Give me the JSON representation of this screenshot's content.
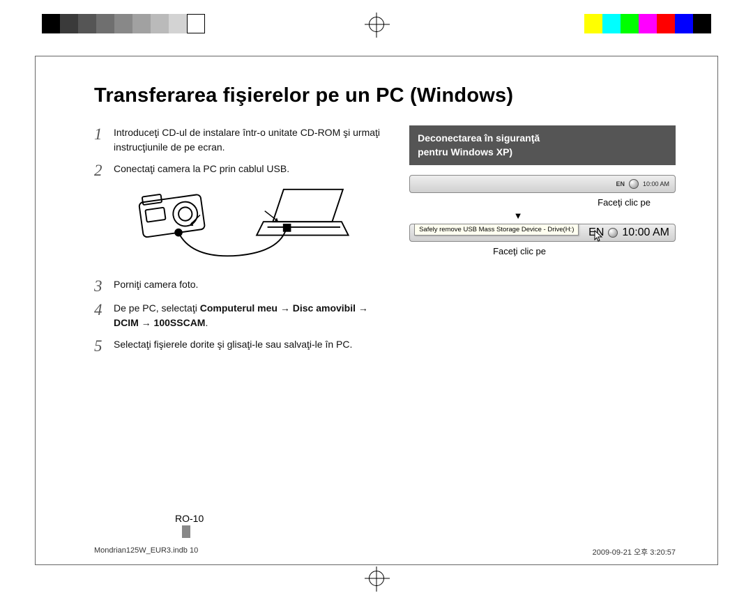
{
  "colorbar": [
    "#000000",
    "#3a3a3a",
    "#555555",
    "#6f6f6f",
    "#888888",
    "#a1a1a1",
    "#bababa",
    "#d3d3d3",
    "#ffffff",
    "#ffffff",
    "#ffff00",
    "#00ffff",
    "#00ff00",
    "#ff00ff",
    "#ff0000",
    "#0000ff",
    "#000000"
  ],
  "title": "Transferarea fişierelor pe un PC (Windows)",
  "steps": {
    "s1": "Introduceţi CD-ul de instalare într-o unitate CD-ROM şi urmaţi instrucţiunile de pe ecran.",
    "s2": "Conectaţi camera la PC prin cablul USB.",
    "s3": "Porniţi camera foto.",
    "s4_prefix": "De pe PC, selectaţi ",
    "s4_bold": "Computerul meu → Disc amovibil → DCIM → 100SSCAM",
    "s4_suffix": ".",
    "s5": "Selectaţi fişierele dorite şi glisaţi-le sau salvaţi-le în PC."
  },
  "sidebar": {
    "header_line1": "Deconectarea în siguranţă",
    "header_line2": "pentru Windows XP)",
    "caption1": "Faceţi clic pe",
    "arrow": "▼",
    "balloon_text": "Safely remove USB Mass Storage Device - Drive(H:)",
    "caption2": "Faceţi clic pe",
    "tray": {
      "lang": "EN",
      "time": "10:00 AM"
    }
  },
  "page_number": "RO-10",
  "footer": {
    "left": "Mondrian125W_EUR3.indb   10",
    "right": "2009-09-21   오후 3:20:57"
  }
}
